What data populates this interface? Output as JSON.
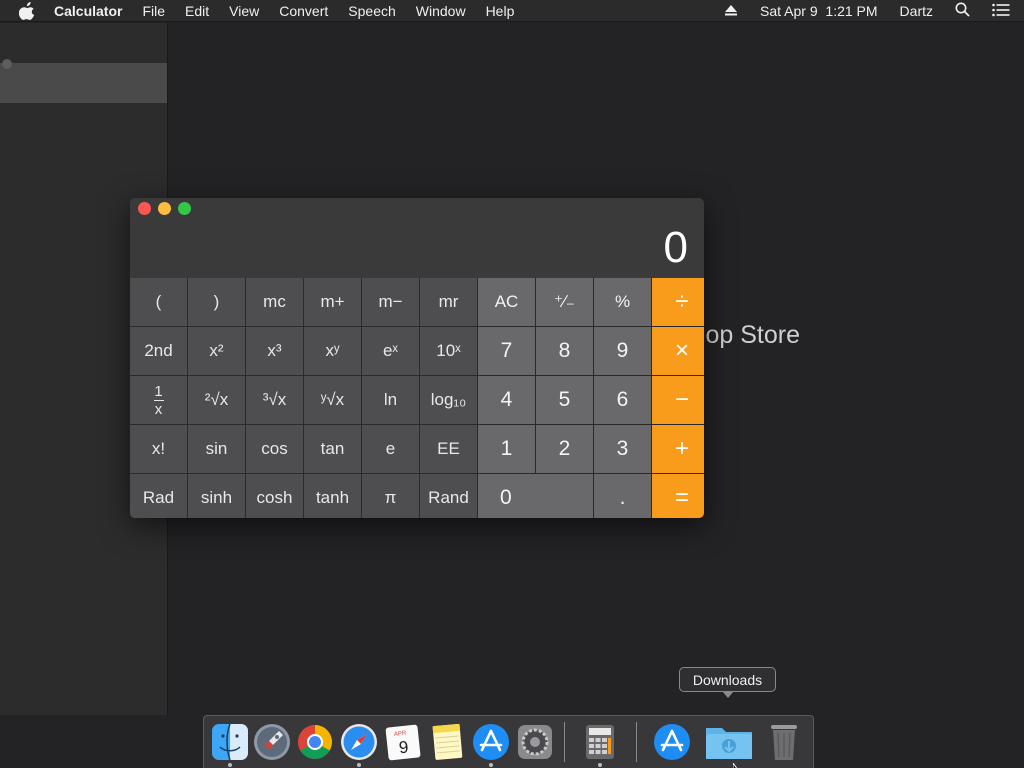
{
  "menubar": {
    "app_name": "Calculator",
    "items": [
      "File",
      "Edit",
      "View",
      "Convert",
      "Speech",
      "Window",
      "Help"
    ],
    "datetime": "Sat Apr 9  1:21 PM",
    "user": "Dartz",
    "icons": [
      "apple-icon",
      "eject-icon",
      "spotlight-search-icon",
      "notification-center-icon"
    ]
  },
  "background_window": {
    "title_partial": "op Store"
  },
  "calculator": {
    "display_value": "0",
    "rows": [
      [
        "(",
        ")",
        "mc",
        "m+",
        "m−",
        "mr",
        "AC",
        "⁺∕₋",
        "%",
        "÷"
      ],
      [
        "2nd",
        "x²",
        "x³",
        "xʸ",
        "eˣ",
        "10ˣ",
        "7",
        "8",
        "9",
        "×"
      ],
      [
        "1/x",
        "²√x",
        "³√x",
        "ʸ√x",
        "ln",
        "log₁₀",
        "4",
        "5",
        "6",
        "−"
      ],
      [
        "x!",
        "sin",
        "cos",
        "tan",
        "e",
        "EE",
        "1",
        "2",
        "3",
        "+"
      ],
      [
        "Rad",
        "sinh",
        "cosh",
        "tanh",
        "π",
        "Rand",
        "0",
        ".",
        "="
      ]
    ],
    "colors": {
      "operator": "#fa9c1b",
      "number": "#69696b",
      "scientific": "#4e4e50",
      "close": "#fc5753",
      "minimize": "#fdbc40",
      "maximize": "#33c748"
    }
  },
  "dock": {
    "apps": [
      "Finder",
      "Launchpad",
      "Google Chrome",
      "Safari",
      "Calendar",
      "Notes",
      "App Store",
      "System Preferences",
      "Calculator",
      "App Store",
      "Downloads",
      "Trash"
    ],
    "calendar_month": "APR",
    "calendar_day": "9",
    "tooltip": "Downloads"
  }
}
